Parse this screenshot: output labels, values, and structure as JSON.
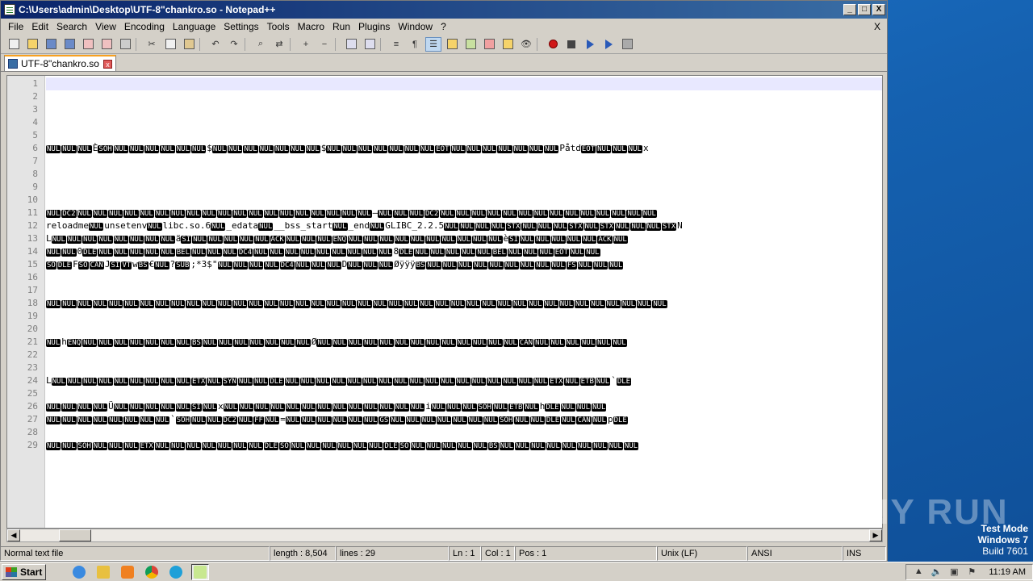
{
  "window": {
    "title": "C:\\Users\\admin\\Desktop\\UTF-8\"chankro.so - Notepad++",
    "min": "_",
    "max": "□",
    "close": "X"
  },
  "menu": {
    "items": [
      "File",
      "Edit",
      "Search",
      "View",
      "Encoding",
      "Language",
      "Settings",
      "Tools",
      "Macro",
      "Run",
      "Plugins",
      "Window",
      "?"
    ],
    "close_doc": "X"
  },
  "tab": {
    "label": "UTF-8\"chankro.so",
    "close": "x"
  },
  "editor": {
    "current_line": 1,
    "lines": [
      {
        "n": "1",
        "text": ""
      },
      {
        "n": "2",
        "text": ""
      },
      {
        "n": "3",
        "text": ""
      },
      {
        "n": "4",
        "text": ""
      },
      {
        "n": "5",
        "text": ""
      },
      {
        "n": "6",
        "text": "NUL NUL NUL È SOH NUL NUL NUL NUL NUL NUL $ NUL NUL NUL NUL NUL NUL NUL $ NUL NUL NUL NUL NUL NUL NUL EOT NUL NUL NUL NUL NUL NUL NUL På td EOT NUL NUL NUL x"
      },
      {
        "n": "7",
        "text": ""
      },
      {
        "n": "8",
        "text": ""
      },
      {
        "n": "9",
        "text": ""
      },
      {
        "n": "10",
        "text": ""
      },
      {
        "n": "11",
        "text": "NUL DC2 NUL NUL NUL NUL NUL NUL NUL NUL NUL NUL NUL NUL NUL NUL NUL NUL NUL NUL NUL — NUL NUL NUL DC2 NUL NUL NUL NUL NUL NUL NUL NUL NUL NUL NUL NUL NUL NUL"
      },
      {
        "n": "12",
        "text": "reloadme NUL unsetenv NUL libc.so.6 NUL _edata NUL __bss_start NUL _end NUL GLIBC_2.2.5 NUL NUL NUL NUL STX NUL NUL NUL STX NUL STX NUL NUL NUL STX N"
      },
      {
        "n": "13",
        "text": "L NUL NUL NUL NUL NUL NUL NUL NUL ä SI NUL NUL NUL NUL NUL ACK NUL NUL NUL ENQ NUL NUL NUL NUL NUL NUL NUL NUL NUL NUL è SI NUL NUL NUL NUL NUL ACK NUL"
      },
      {
        "n": "14",
        "text": "NUL NUL 0 DLE NUL NUL NUL NUL NUL BEL NUL NUL NUL DC4 NUL NUL NUL NUL NUL NUL NUL NUL NUL 8 DLE NUL NUL NUL NUL NUL BEL NUL NUL NUL EOT NUL NUL"
      },
      {
        "n": "15",
        "text": "SO DLE F SO CAN J SI VT w BS € NUL ? SUB ;*3$\" NUL NUL NUL NUL DC4 NUL NUL NUL D NUL NUL NUL Øÿÿÿ BS NUL NUL NUL NUL NUL NUL NUL NUL NUL FS NUL NUL NUL"
      },
      {
        "n": "16",
        "text": ""
      },
      {
        "n": "17",
        "text": ""
      },
      {
        "n": "18",
        "text": "NUL NUL NUL NUL NUL NUL NUL NUL NUL NUL NUL NUL NUL NUL NUL NUL NUL NUL NUL NUL NUL NUL NUL NUL NUL NUL NUL NUL NUL NUL NUL NUL NUL NUL NUL NUL NUL NUL NUL NUL"
      },
      {
        "n": "19",
        "text": ""
      },
      {
        "n": "20",
        "text": ""
      },
      {
        "n": "21",
        "text": "NUL h ENQ NUL NUL NUL NUL NUL NUL NUL BS NUL NUL NUL NUL NUL NUL NUL Ø NUL NUL NUL NUL NUL NUL NUL NUL NUL NUL NUL NUL NUL CAN NUL NUL NUL NUL NUL NUL"
      },
      {
        "n": "22",
        "text": ""
      },
      {
        "n": "23",
        "text": ""
      },
      {
        "n": "24",
        "text": "L NUL NUL NUL NUL NUL NUL NUL NUL NUL ETX NUL SYN NUL NUL DLE NUL NUL NUL NUL NUL NUL NUL NUL NUL NUL NUL NUL NUL NUL NUL NUL NUL ETX NUL ETB NUL ` DLE"
      },
      {
        "n": "25",
        "text": ""
      },
      {
        "n": "26",
        "text": "NUL NUL NUL NUL Ü NUL NUL NUL NUL NUL SI NUL x NUL NUL NUL NUL NUL NUL NUL NUL NUL NUL NUL NUL NUL i NUL NUL NUL SOH NUL ETB NUL h DLE NUL NUL NUL"
      },
      {
        "n": "27",
        "text": "NUL NUL NUL NUL NUL NUL NUL NUL ` SOH NUL NUL DC2 NUL FF NUL = NUL NUL NUL NUL NUL NUL GS NUL NUL NUL NUL NUL NUL NUL SOH NUL NUL DLE NUL CAN NUL p DLE"
      },
      {
        "n": "28",
        "text": ""
      },
      {
        "n": "29",
        "text": "NUL NUL SOH NUL NUL NUL ETX NUL NUL NUL NUL NUL NUL NUL DLE SO NUL NUL NUL NUL NUL NUL DLE SO NUL NUL NUL NUL NUL BS NUL NUL NUL NUL NUL NUL NUL NUL NUL"
      }
    ]
  },
  "status": {
    "filetype": "Normal text file",
    "length": "length : 8,504",
    "lines": "lines : 29",
    "ln": "Ln : 1",
    "col": "Col : 1",
    "pos": "Pos : 1",
    "eol": "Unix (LF)",
    "encoding": "ANSI",
    "mode": "INS"
  },
  "desktop": {
    "watermark": "ANY RUN",
    "testmode_line1": "Test Mode",
    "testmode_line2": "Windows 7",
    "testmode_line3": "Build 7601"
  },
  "taskbar": {
    "start_label": "Start",
    "clock": "11:19 AM"
  }
}
